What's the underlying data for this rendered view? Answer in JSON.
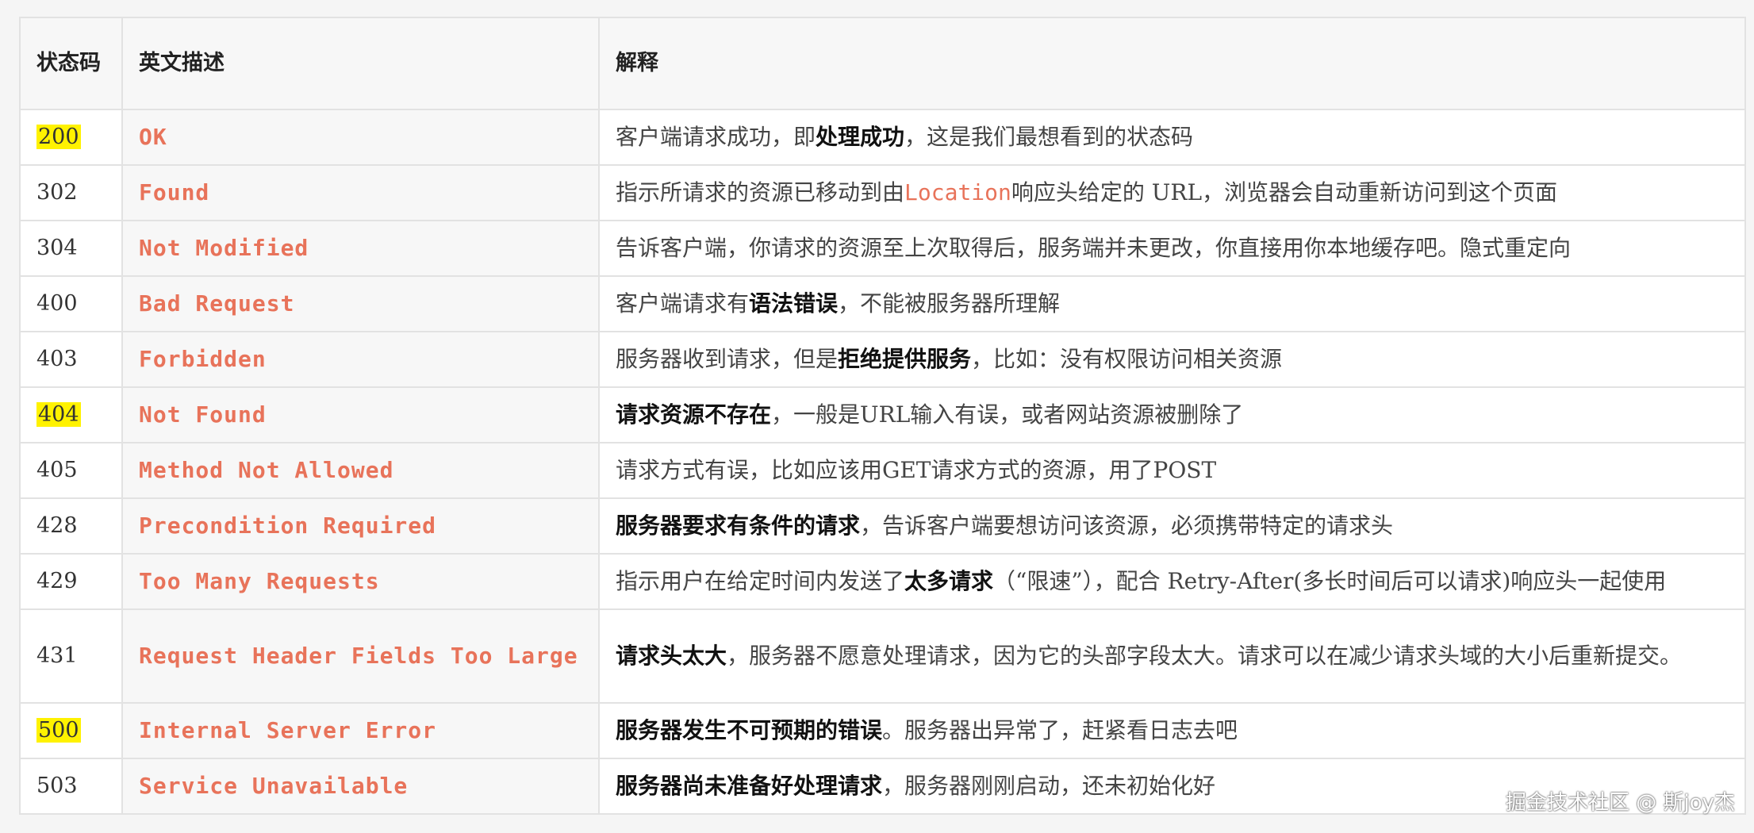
{
  "table": {
    "headers": [
      "状态码",
      "英文描述",
      "解释"
    ],
    "rows": [
      {
        "code": "200",
        "highlight": true,
        "name": "OK",
        "desc": [
          {
            "t": "客户端请求成功，即"
          },
          {
            "t": "处理成功",
            "b": true
          },
          {
            "t": "，这是我们最想看到的状态码"
          }
        ]
      },
      {
        "code": "302",
        "highlight": false,
        "name": "Found",
        "desc": [
          {
            "t": "指示所请求的资源已移动到由"
          },
          {
            "t": "Location",
            "c": true
          },
          {
            "t": "响应头给定的 URL，浏览器会自动重新访问到这个页面"
          }
        ]
      },
      {
        "code": "304",
        "highlight": false,
        "name": "Not Modified",
        "desc": [
          {
            "t": "告诉客户端，你请求的资源至上次取得后，服务端并未更改，你直接用你本地缓存吧。隐式重定向"
          }
        ]
      },
      {
        "code": "400",
        "highlight": false,
        "name": "Bad Request",
        "desc": [
          {
            "t": "客户端请求有"
          },
          {
            "t": "语法错误",
            "b": true
          },
          {
            "t": "，不能被服务器所理解"
          }
        ]
      },
      {
        "code": "403",
        "highlight": false,
        "name": "Forbidden",
        "desc": [
          {
            "t": "服务器收到请求，但是"
          },
          {
            "t": "拒绝提供服务",
            "b": true
          },
          {
            "t": "，比如：没有权限访问相关资源"
          }
        ]
      },
      {
        "code": "404",
        "highlight": true,
        "name": "Not Found",
        "desc": [
          {
            "t": "请求资源不存在",
            "b": true
          },
          {
            "t": "，一般是URL输入有误，或者网站资源被删除了"
          }
        ]
      },
      {
        "code": "405",
        "highlight": false,
        "name": "Method Not Allowed",
        "desc": [
          {
            "t": "请求方式有误，比如应该用GET请求方式的资源，用了POST"
          }
        ]
      },
      {
        "code": "428",
        "highlight": false,
        "name": "Precondition Required",
        "desc": [
          {
            "t": "服务器要求有条件的请求",
            "b": true
          },
          {
            "t": "，告诉客户端要想访问该资源，必须携带特定的请求头"
          }
        ]
      },
      {
        "code": "429",
        "highlight": false,
        "name": "Too Many Requests",
        "desc": [
          {
            "t": "指示用户在给定时间内发送了"
          },
          {
            "t": "太多请求",
            "b": true
          },
          {
            "t": "（“限速”），配合 Retry-After(多长时间后可以请求)响应头一起使用"
          }
        ]
      },
      {
        "code": "431",
        "highlight": false,
        "tall": true,
        "name": "Request Header Fields Too Large",
        "desc": [
          {
            "t": "请求头太大",
            "b": true
          },
          {
            "t": "，服务器不愿意处理请求，因为它的头部字段太大。请求可以在减少请求头域的大小后重新提交。"
          }
        ]
      },
      {
        "code": "500",
        "highlight": true,
        "name": "Internal Server Error",
        "desc": [
          {
            "t": "服务器发生不可预期的错误",
            "b": true
          },
          {
            "t": "。服务器出异常了，赶紧看日志去吧"
          }
        ]
      },
      {
        "code": "503",
        "highlight": false,
        "name": "Service Unavailable",
        "desc": [
          {
            "t": "服务器尚未准备好处理请求",
            "b": true
          },
          {
            "t": "，服务器刚刚启动，还未初始化好"
          }
        ]
      }
    ]
  },
  "watermark": "掘金技术社区 @ 斯joy杰",
  "colors": {
    "name_text": "#e8735a",
    "highlight": "#fff200"
  }
}
